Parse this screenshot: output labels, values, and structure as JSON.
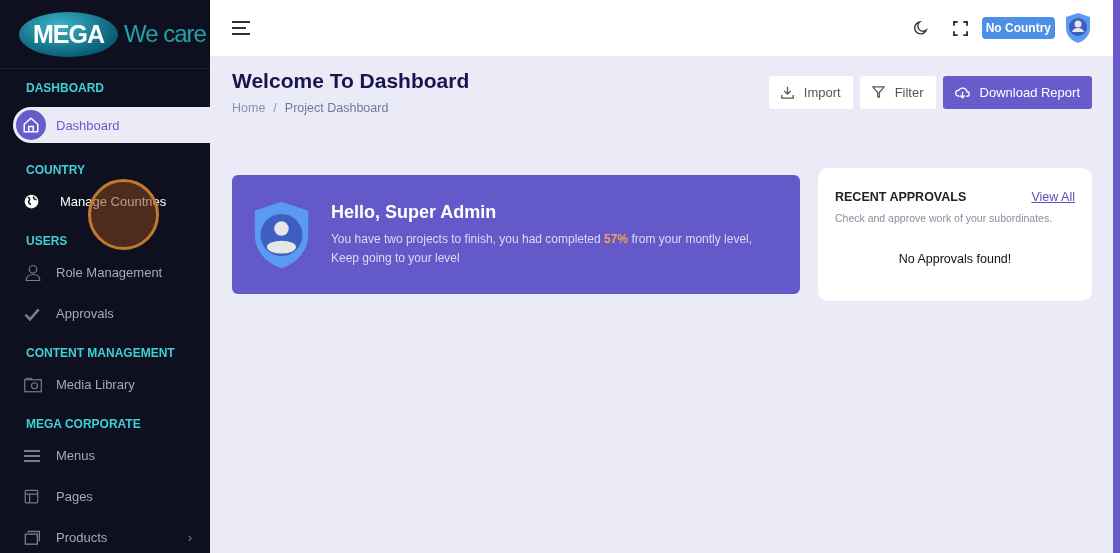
{
  "logo": {
    "badge": "MEGA",
    "tagline": "We care"
  },
  "sidebar": {
    "items": [
      {
        "kind": "header",
        "label": "DASHBOARD"
      },
      {
        "kind": "item",
        "label": "Dashboard",
        "selected": true,
        "hovered": false
      },
      {
        "kind": "header",
        "label": "COUNTRY"
      },
      {
        "kind": "item",
        "label": "Manage Countries",
        "selected": false,
        "hovered": true
      },
      {
        "kind": "header",
        "label": "USERS"
      },
      {
        "kind": "item",
        "label": "Role Management",
        "selected": false,
        "hovered": false
      },
      {
        "kind": "item",
        "label": "Approvals",
        "selected": false,
        "hovered": false
      },
      {
        "kind": "header",
        "label": "CONTENT MANAGEMENT"
      },
      {
        "kind": "item",
        "label": "Media Library",
        "selected": false,
        "hovered": false
      },
      {
        "kind": "header",
        "label": "MEGA CORPORATE"
      },
      {
        "kind": "item",
        "label": "Menus",
        "selected": false,
        "hovered": false
      },
      {
        "kind": "item",
        "label": "Pages",
        "selected": false,
        "hovered": false
      },
      {
        "kind": "item",
        "label": "Products",
        "selected": false,
        "hovered": false,
        "chevron": "›"
      }
    ]
  },
  "topbar": {
    "country_badge": "No Country"
  },
  "page": {
    "title": "Welcome To Dashboard",
    "breadcrumb": [
      "Home",
      "Project Dashboard"
    ],
    "breadcrumb_separator": "/",
    "actions": [
      {
        "kind": "import",
        "label": "Import"
      },
      {
        "kind": "filter",
        "label": "Filter"
      },
      {
        "kind": "download",
        "label": "Download Report"
      }
    ]
  },
  "welcome": {
    "greeting": "Hello, Super Admin",
    "message": "You have two projects to finish, you had completed **57%** from your montly level, Keep going to your level"
  },
  "approvals": {
    "title": "RECENT APPROVALS",
    "link": "View All",
    "subtitle": "Check and approve work of your subordinates.",
    "empty": "No Approvals found!"
  }
}
